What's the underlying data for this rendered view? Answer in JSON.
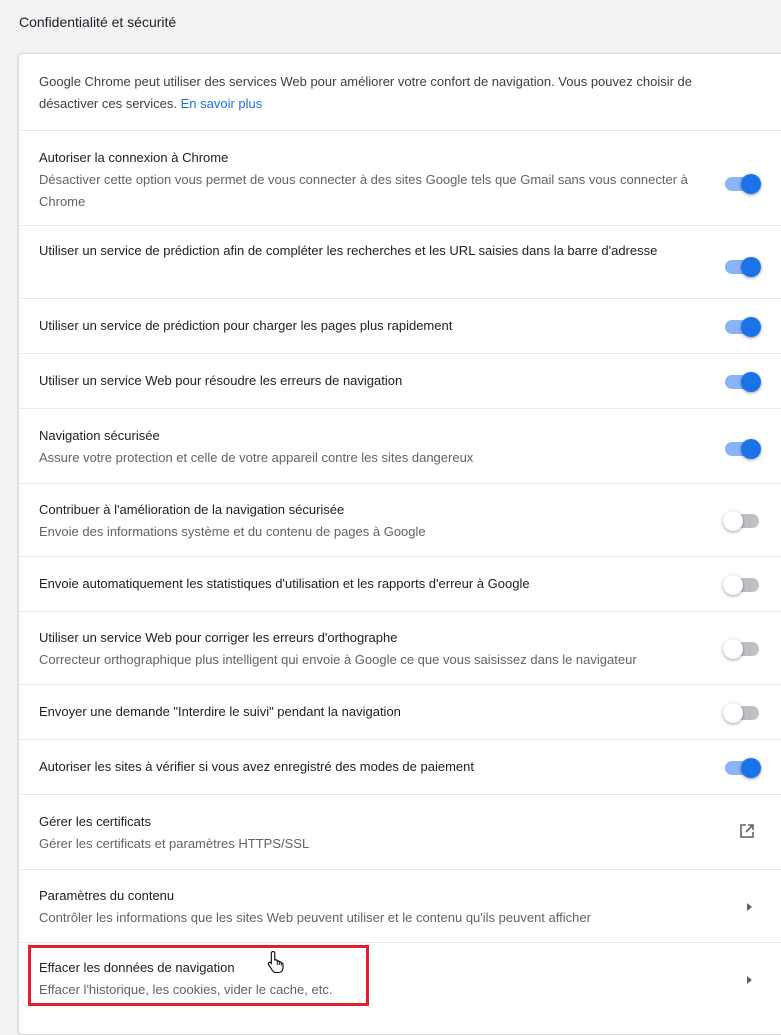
{
  "section_title": "Confidentialité et sécurité",
  "intro": {
    "text": "Google Chrome peut utiliser des services Web pour améliorer votre confort de navigation. Vous pouvez choisir de désactiver ces services. ",
    "link": "En savoir plus"
  },
  "settings": [
    {
      "title": "Autoriser la connexion à Chrome",
      "subtitle": "Désactiver cette option vous permet de vous connecter à des sites Google tels que Gmail sans vous connecter à Chrome",
      "state": "on"
    },
    {
      "title": "Utiliser un service de prédiction afin de compléter les recherches et les URL saisies dans la barre d'adresse",
      "subtitle": "",
      "state": "on"
    },
    {
      "title": "Utiliser un service de prédiction pour charger les pages plus rapidement",
      "subtitle": "",
      "state": "on"
    },
    {
      "title": "Utiliser un service Web pour résoudre les erreurs de navigation",
      "subtitle": "",
      "state": "on"
    },
    {
      "title": "Navigation sécurisée",
      "subtitle": "Assure votre protection et celle de votre appareil contre les sites dangereux",
      "state": "on"
    },
    {
      "title": "Contribuer à l'amélioration de la navigation sécurisée",
      "subtitle": "Envoie des informations système et du contenu de pages à Google",
      "state": "off"
    },
    {
      "title": "Envoie automatiquement les statistiques d'utilisation et les rapports d'erreur à Google",
      "subtitle": "",
      "state": "off"
    },
    {
      "title": "Utiliser un service Web pour corriger les erreurs d'orthographe",
      "subtitle": "Correcteur orthographique plus intelligent qui envoie à Google ce que vous saisissez dans le navigateur",
      "state": "off"
    },
    {
      "title": "Envoyer une demande \"Interdire le suivi\" pendant la navigation",
      "subtitle": "",
      "state": "off"
    },
    {
      "title": "Autoriser les sites à vérifier si vous avez enregistré des modes de paiement",
      "subtitle": "",
      "state": "on"
    }
  ],
  "certificates": {
    "title": "Gérer les certificats",
    "subtitle": "Gérer les certificats et paramètres HTTPS/SSL",
    "icon": "open-in-new-icon"
  },
  "content_settings": {
    "title": "Paramètres du contenu",
    "subtitle": "Contrôler les informations que les sites Web peuvent utiliser et le contenu qu'ils peuvent afficher",
    "icon": "chevron-right-icon"
  },
  "clear_data": {
    "title": "Effacer les données de navigation",
    "subtitle": "Effacer l'historique, les cookies, vider le cache, etc.",
    "icon": "chevron-right-icon"
  },
  "colors": {
    "accent": "#1a73e8",
    "highlight": "#e0202a"
  }
}
